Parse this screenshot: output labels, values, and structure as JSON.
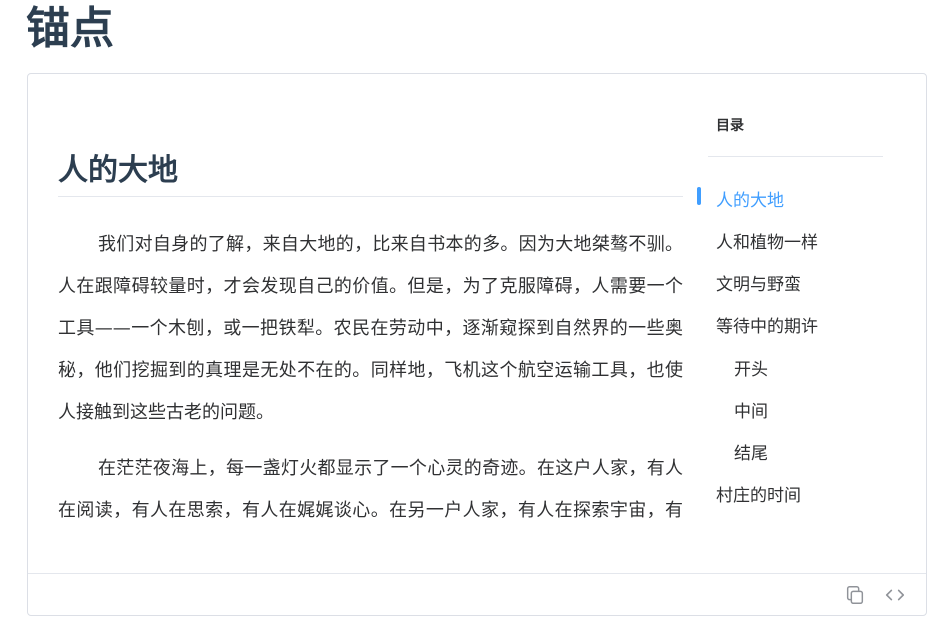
{
  "page": {
    "title": "锚点"
  },
  "article": {
    "heading": "人的大地",
    "paragraphs": [
      "我们对自身的了解，来自大地的，比来自书本的多。因为大地桀骜不驯。人在跟障碍较量时，才会发现自己的价值。但是，为了克服障碍，人需要一个工具——一个木刨，或一把铁犁。农民在劳动中，逐渐窥探到自然界的一些奥秘，他们挖掘到的真理是无处不在的。同样地，飞机这个航空运输工具，也使人接触到这些古老的问题。",
      "在茫茫夜海上，每一盏灯火都显示了一个心灵的奇迹。在这户人家，有人在阅读，有人在思索，有人在娓娓谈心。在另一户人家，有人在探索宇宙，有人在推算仙女座星云的运动。那里，有人在爱。"
    ]
  },
  "toc": {
    "title": "目录",
    "items": [
      {
        "label": "人的大地",
        "active": true
      },
      {
        "label": "人和植物一样",
        "active": false
      },
      {
        "label": "文明与野蛮",
        "active": false
      },
      {
        "label": "等待中的期许",
        "active": false
      },
      {
        "label": "开头",
        "active": false
      },
      {
        "label": "中间",
        "active": false
      },
      {
        "label": "结尾",
        "active": false
      },
      {
        "label": "村庄的时间",
        "active": false
      }
    ]
  },
  "footer": {
    "icons": [
      "copy-icon",
      "code-icon"
    ]
  },
  "colors": {
    "accent": "#409eff",
    "text": "#303133",
    "heading": "#2c3e50",
    "border": "#dcdfe6",
    "icon": "#909399"
  }
}
